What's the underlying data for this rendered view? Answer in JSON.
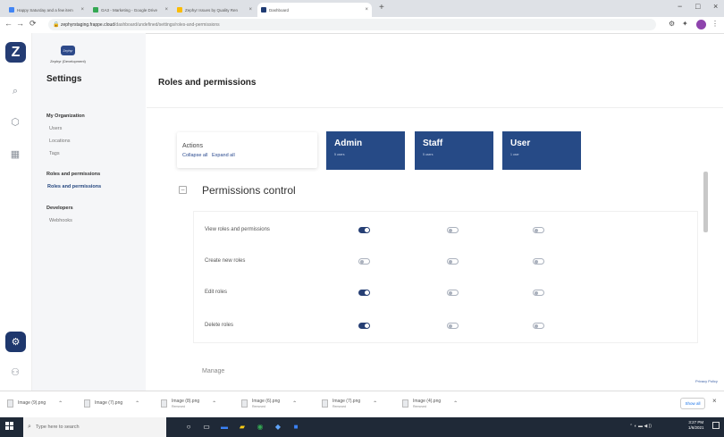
{
  "browser": {
    "tabs": [
      {
        "title": "Happy Saturday and a few item",
        "color": "#4285f4"
      },
      {
        "title": "GA3 - Marketing - Google Drive",
        "color": "#34a853"
      },
      {
        "title": "Zephyr Issues by Quality Ren",
        "color": "#fbbc04"
      },
      {
        "title": "Dashboard",
        "color": "#1f3b73"
      }
    ],
    "url_host": "zephyrstaging.frappe.cloud",
    "url_path": "/dashboard/undefined/settings/roles-and-permissions",
    "nav": {
      "back": "←",
      "forward": "→",
      "reload": "⟳"
    },
    "window_controls": {
      "minimize": "−",
      "maximize": "□",
      "close": "×"
    },
    "new_tab": "+"
  },
  "rail": {
    "logo": "Z",
    "icons": {
      "search": "⌕",
      "cube": "⬡",
      "building": "▦",
      "gear": "⚙",
      "user": "⚇"
    }
  },
  "sidebar": {
    "workspace_badge": "Zephyr",
    "org_name": "Zephyr (Development)",
    "title": "Settings",
    "sections": [
      {
        "title": "My Organization",
        "links": [
          "Users",
          "Locations",
          "Tags"
        ]
      },
      {
        "title": "Roles and permissions",
        "links": [
          "Roles and permissions"
        ]
      },
      {
        "title": "Developers",
        "links": [
          "Webhooks"
        ]
      }
    ]
  },
  "main": {
    "title": "Roles and permissions",
    "actions": {
      "label": "Actions",
      "collapse": "Collapse all",
      "expand": "Expand all"
    },
    "roles": [
      {
        "name": "Admin",
        "count": "5 users"
      },
      {
        "name": "Staff",
        "count": "5 users"
      },
      {
        "name": "User",
        "count": "1 user"
      }
    ],
    "section_toggle": "−",
    "section_title": "Permissions control",
    "permissions": [
      {
        "label": "View roles and permissions",
        "admin": true,
        "staff": false,
        "user": false
      },
      {
        "label": "Create new roles",
        "admin": false,
        "staff": false,
        "user": false
      },
      {
        "label": "Edit roles",
        "admin": true,
        "staff": false,
        "user": false
      },
      {
        "label": "Delete roles",
        "admin": true,
        "staff": false,
        "user": false
      }
    ],
    "next_section": "Manage",
    "privacy_link": "Privacy Policy"
  },
  "downloads": {
    "items": [
      {
        "name": "Image (9).png",
        "sub": ""
      },
      {
        "name": "Image (7).png",
        "sub": ""
      },
      {
        "name": "Image (8).png",
        "sub": "Removed"
      },
      {
        "name": "Image (6).png",
        "sub": "Removed"
      },
      {
        "name": "Image (7).png",
        "sub": "Removed"
      },
      {
        "name": "Image (4).png",
        "sub": "Removed"
      }
    ],
    "show_all": "Show all",
    "close": "×"
  },
  "taskbar": {
    "search_placeholder": "Type here to search",
    "time": "3:27 PM",
    "date": "1/6/2021"
  },
  "colors": {
    "primary": "#264a86",
    "sidebar_bg": "#f5f6f8",
    "toggle_on": "#263f74"
  }
}
